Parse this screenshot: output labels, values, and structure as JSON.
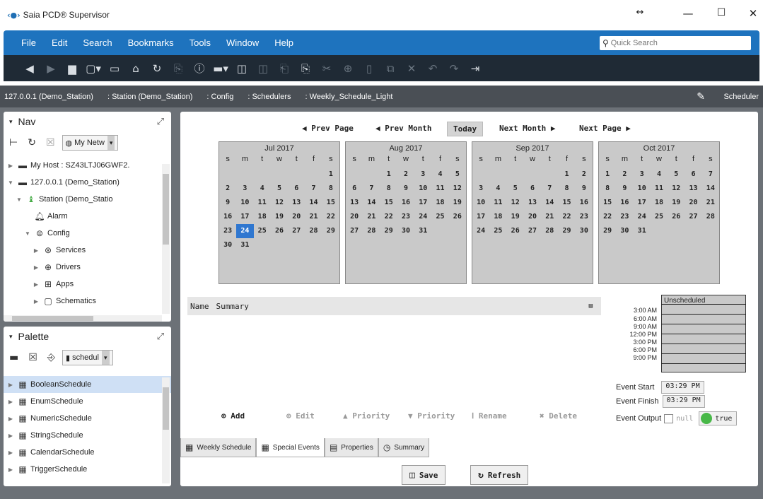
{
  "window": {
    "title": "Saia PCD® Supervisor",
    "logo": "‹●›"
  },
  "menu": [
    "File",
    "Edit",
    "Search",
    "Bookmarks",
    "Tools",
    "Window",
    "Help"
  ],
  "search": {
    "placeholder": "Quick Search"
  },
  "path": [
    "127.0.0.1 (Demo_Station)",
    ": Station (Demo_Station)",
    ": Config",
    ": Schedulers",
    ": Weekly_Schedule_Light"
  ],
  "view_label": "Scheduler",
  "nav": {
    "title": "Nav",
    "dropdown": "My Netw",
    "items": [
      {
        "label": "My Host : SZ43LTJ06GWF2."
      },
      {
        "label": "127.0.0.1 (Demo_Station)"
      },
      {
        "label": "Station (Demo_Statio"
      },
      {
        "label": "Alarm"
      },
      {
        "label": "Config"
      },
      {
        "label": "Services"
      },
      {
        "label": "Drivers"
      },
      {
        "label": "Apps"
      },
      {
        "label": "Schematics"
      }
    ]
  },
  "palette": {
    "title": "Palette",
    "dropdown": "schedul",
    "items": [
      {
        "label": "BooleanSchedule"
      },
      {
        "label": "EnumSchedule"
      },
      {
        "label": "NumericSchedule"
      },
      {
        "label": "StringSchedule"
      },
      {
        "label": "CalendarSchedule"
      },
      {
        "label": "TriggerSchedule"
      }
    ]
  },
  "calendar_nav": {
    "prev_page": "◀ Prev Page",
    "prev_month": "◀ Prev Month",
    "today": "Today",
    "next_month": "Next Month ▶",
    "next_page": "Next Page ▶"
  },
  "day_headers": [
    "s",
    "m",
    "t",
    "w",
    "t",
    "f",
    "s"
  ],
  "months": [
    {
      "name": "Jul 2017",
      "weeks": [
        [
          "",
          "",
          "",
          "",
          "",
          "",
          "1"
        ],
        [
          "2",
          "3",
          "4",
          "5",
          "6",
          "7",
          "8"
        ],
        [
          "9",
          "10",
          "11",
          "12",
          "13",
          "14",
          "15"
        ],
        [
          "16",
          "17",
          "18",
          "19",
          "20",
          "21",
          "22"
        ],
        [
          "23",
          "24",
          "25",
          "26",
          "27",
          "28",
          "29"
        ],
        [
          "30",
          "31",
          "",
          "",
          "",
          "",
          ""
        ]
      ],
      "today": "24"
    },
    {
      "name": "Aug 2017",
      "weeks": [
        [
          "",
          "",
          "1",
          "2",
          "3",
          "4",
          "5"
        ],
        [
          "6",
          "7",
          "8",
          "9",
          "10",
          "11",
          "12"
        ],
        [
          "13",
          "14",
          "15",
          "16",
          "17",
          "18",
          "19"
        ],
        [
          "20",
          "21",
          "22",
          "23",
          "24",
          "25",
          "26"
        ],
        [
          "27",
          "28",
          "29",
          "30",
          "31",
          "",
          ""
        ]
      ],
      "today": ""
    },
    {
      "name": "Sep 2017",
      "weeks": [
        [
          "",
          "",
          "",
          "",
          "",
          "1",
          "2"
        ],
        [
          "3",
          "4",
          "5",
          "6",
          "7",
          "8",
          "9"
        ],
        [
          "10",
          "11",
          "12",
          "13",
          "14",
          "15",
          "16"
        ],
        [
          "17",
          "18",
          "19",
          "20",
          "21",
          "22",
          "23"
        ],
        [
          "24",
          "25",
          "26",
          "27",
          "28",
          "29",
          "30"
        ]
      ],
      "today": ""
    },
    {
      "name": "Oct 2017",
      "weeks": [
        [
          "1",
          "2",
          "3",
          "4",
          "5",
          "6",
          "7"
        ],
        [
          "8",
          "9",
          "10",
          "11",
          "12",
          "13",
          "14"
        ],
        [
          "15",
          "16",
          "17",
          "18",
          "19",
          "20",
          "21"
        ],
        [
          "22",
          "23",
          "24",
          "25",
          "26",
          "27",
          "28"
        ],
        [
          "29",
          "30",
          "31",
          "",
          "",
          "",
          ""
        ]
      ],
      "today": ""
    }
  ],
  "grid": {
    "col_name": "Name",
    "col_summary": "Summary"
  },
  "actions": {
    "add": "Add",
    "edit": "Edit",
    "priority_up": "Priority",
    "priority_down": "Priority",
    "rename": "Rename",
    "delete": "Delete"
  },
  "legend": {
    "unscheduled": "Unscheduled",
    "times": [
      "3:00 AM",
      "6:00 AM",
      "9:00 AM",
      "12:00 PM",
      "3:00 PM",
      "6:00 PM",
      "9:00 PM"
    ]
  },
  "event": {
    "start_label": "Event Start",
    "start_value": "03:29 PM",
    "finish_label": "Event Finish",
    "finish_value": "03:29 PM",
    "output_label": "Event Output",
    "null_label": "null",
    "true_label": "true",
    "true_color": "#48b848"
  },
  "tabs": [
    "Weekly Schedule",
    "Special Events",
    "Properties",
    "Summary"
  ],
  "buttons": {
    "save": "Save",
    "refresh": "Refresh"
  },
  "colors": {
    "accent": "#1e73be",
    "today_highlight": "#2f77d0"
  }
}
